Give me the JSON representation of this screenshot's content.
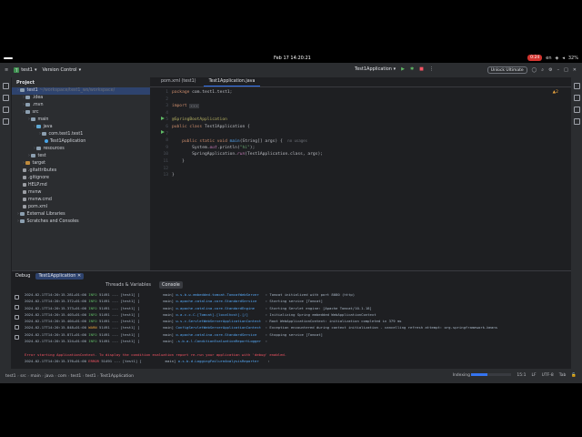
{
  "system": {
    "clock": "Feb 17  14:20:21",
    "rec_badge": "0:24",
    "lang": "en",
    "battery": "32%"
  },
  "titlebar": {
    "project_badge": "T",
    "project_name": "test1",
    "vcs": "Version Control",
    "run_config": "Test1Application",
    "unlock": "Unlock Ultimate"
  },
  "project": {
    "title": "Project",
    "rows": [
      {
        "label": "test1",
        "hint": "~/workspace/test1_ws/workspace/",
        "icon": "folder",
        "indent": 0,
        "selected": true
      },
      {
        "label": ".idea",
        "hint": "",
        "icon": "folder",
        "indent": 1
      },
      {
        "label": ".mvn",
        "hint": "",
        "icon": "folder",
        "indent": 1
      },
      {
        "label": "src",
        "hint": "",
        "icon": "folder",
        "indent": 1
      },
      {
        "label": "main",
        "hint": "",
        "icon": "folder",
        "indent": 2
      },
      {
        "label": "java",
        "hint": "",
        "icon": "src",
        "indent": 3
      },
      {
        "label": "com.test1.test1",
        "hint": "",
        "icon": "folder",
        "indent": 4
      },
      {
        "label": "Test1Application",
        "hint": "",
        "icon": "java",
        "indent": 5
      },
      {
        "label": "resources",
        "hint": "",
        "icon": "folder",
        "indent": 3
      },
      {
        "label": "test",
        "hint": "",
        "icon": "folder",
        "indent": 2
      },
      {
        "label": "target",
        "hint": "",
        "icon": "target",
        "indent": 1
      },
      {
        "label": ".gitattributes",
        "hint": "",
        "icon": "file",
        "indent": 1
      },
      {
        "label": ".gitignore",
        "hint": "",
        "icon": "file",
        "indent": 1
      },
      {
        "label": "HELP.md",
        "hint": "",
        "icon": "file",
        "indent": 1
      },
      {
        "label": "mvnw",
        "hint": "",
        "icon": "file",
        "indent": 1
      },
      {
        "label": "mvnw.cmd",
        "hint": "",
        "icon": "file",
        "indent": 1
      },
      {
        "label": "pom.xml",
        "hint": "",
        "icon": "file",
        "indent": 1
      },
      {
        "label": "External Libraries",
        "hint": "",
        "icon": "folder",
        "indent": 0
      },
      {
        "label": "Scratches and Consoles",
        "hint": "",
        "icon": "folder",
        "indent": 0
      }
    ]
  },
  "editor": {
    "tabs": [
      {
        "label": "pom.xml (test1)",
        "active": false
      },
      {
        "label": "Test1Application.java",
        "active": true
      }
    ],
    "warnings": "▲2",
    "line_numbers": [
      "1",
      "2",
      "3",
      "4",
      "5",
      "6",
      "7",
      "8",
      "9",
      "10",
      "11",
      "12",
      "13"
    ],
    "code": {
      "l1_kw": "package ",
      "l1_rest": "com.test1.test1;",
      "l3_kw": "import ",
      "l3_rest": "...",
      "l5_an": "@SpringBootApplication",
      "l6_kw": "public class ",
      "l6_rest": "Test1Application {",
      "l8_kw": "    public static void ",
      "l8_fn": "main",
      "l8_rest": "(String[] args) {",
      "l8_hint": "no usages",
      "l9_pre": "        System.",
      "l9_it": "out",
      "l9_mid": ".println(",
      "l9_st": "\"hi\"",
      "l9_end": ");",
      "l10_pre": "        SpringApplication.",
      "l10_it": "run",
      "l10_rest": "(Test1Application.class, args);",
      "l11": "    }",
      "l13": "}"
    }
  },
  "debug": {
    "title": "Debug",
    "session": "Test1Application",
    "subtabs": [
      "Threads & Variables",
      "Console"
    ],
    "active_subtab": "Console",
    "log": [
      {
        "ts": "2024-02-17T14:20:15.281+01:00",
        "lvl": "INFO",
        "pid": "51491",
        "thread": "[test1] [           main]",
        "logger": "o.s.b.w.embedded.tomcat.TomcatWebServer ",
        "msg": " : Tomcat initialized with port 8080 (http)"
      },
      {
        "ts": "2024-02-17T14:20:15.372+01:00",
        "lvl": "INFO",
        "pid": "51491",
        "thread": "[test1] [           main]",
        "logger": "o.apache.catalina.core.StandardService  ",
        "msg": " : Starting service [Tomcat]"
      },
      {
        "ts": "2024-02-17T14:20:15.373+01:00",
        "lvl": "INFO",
        "pid": "51491",
        "thread": "[test1] [           main]",
        "logger": "o.apache.catalina.core.StandardEngine   ",
        "msg": " : Starting Servlet engine: [Apache Tomcat/10.1.18]"
      },
      {
        "ts": "2024-02-17T14:20:15.403+01:00",
        "lvl": "INFO",
        "pid": "51491",
        "thread": "[test1] [           main]",
        "logger": "o.a.c.c.C.[Tomcat].[localhost].[/]      ",
        "msg": " : Initializing Spring embedded WebApplicationContext"
      },
      {
        "ts": "2024-02-17T14:20:15.404+01:00",
        "lvl": "INFO",
        "pid": "51491",
        "thread": "[test1] [           main]",
        "logger": "w.s.c.ServletWebServerApplicationContext",
        "msg": " : Root WebApplicationContext: initialization completed in 379 ms"
      },
      {
        "ts": "2024-02-17T14:20:15.848+01:00",
        "lvl": "WARN",
        "pid": "51491",
        "thread": "[test1] [           main]",
        "logger": "ConfigServletWebServerApplicationContext",
        "msg": " : Exception encountered during context initialization - cancelling refresh attempt: org.springframework.beans"
      },
      {
        "ts": "2024-02-17T14:20:15.871+01:00",
        "lvl": "INFO",
        "pid": "51491",
        "thread": "[test1] [           main]",
        "logger": "o.apache.catalina.core.StandardService  ",
        "msg": " : Stopping service [Tomcat]"
      },
      {
        "ts": "2024-02-17T14:20:15.324+01:00",
        "lvl": "INFO",
        "pid": "51491",
        "thread": "[test1] [           main]",
        "logger": ".s.b.a.l.ConditionEvaluationReportLogger",
        "msg": " : "
      }
    ],
    "error_line": "Error starting ApplicationContext. To display the condition evaluation report re-run your application with 'debug' enabled.",
    "last_line": {
      "ts": "2024-02-17T14:20:15.376+01:00",
      "lvl": "ERROR",
      "pid": "51491",
      "thread": "[test1] [           main]",
      "logger": "o.s.b.d.LoggingFailureAnalysisReporter  ",
      "msg": " : "
    }
  },
  "statusbar": {
    "crumbs": [
      "test1",
      "src",
      "main",
      "java",
      "com",
      "test1",
      "test1",
      "Test1Application"
    ],
    "indexing": "Indexing",
    "indexing_progress": 0.4,
    "position": "15:1",
    "line_sep": "LF",
    "encoding": "UTF-8",
    "indent": "Tab"
  }
}
